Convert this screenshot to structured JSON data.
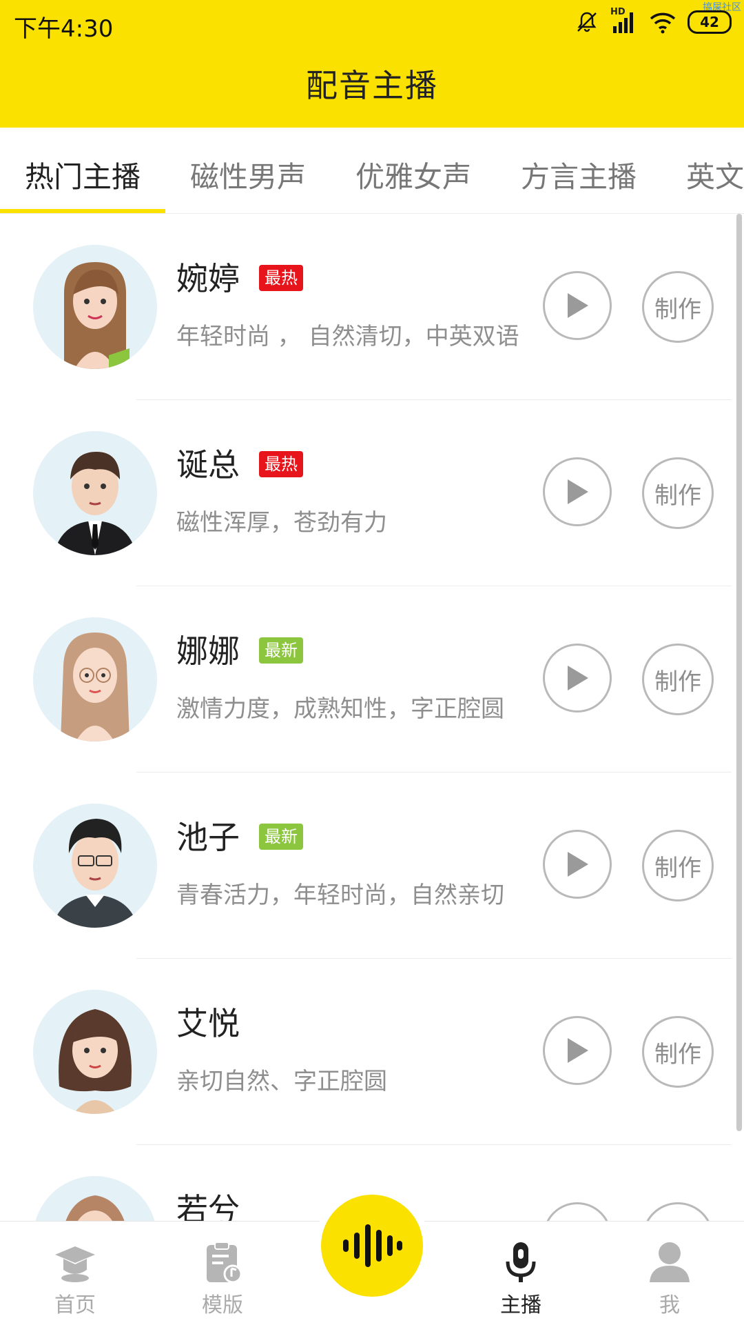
{
  "status_bar": {
    "time": "下午4:30",
    "battery": "42",
    "hd": "HD",
    "watermark": "搞屎社区"
  },
  "header": {
    "title": "配音主播"
  },
  "tabs": [
    {
      "label": "热门主播",
      "active": true
    },
    {
      "label": "磁性男声",
      "active": false
    },
    {
      "label": "优雅女声",
      "active": false
    },
    {
      "label": "方言主播",
      "active": false
    },
    {
      "label": "英文",
      "active": false
    }
  ],
  "anchors": [
    {
      "name": "婉婷",
      "badge": "最热",
      "badge_type": "hot",
      "desc": "年轻时尚 ， 自然清切，中英双语"
    },
    {
      "name": "诞总",
      "badge": "最热",
      "badge_type": "hot",
      "desc": "磁性浑厚，苍劲有力"
    },
    {
      "name": "娜娜",
      "badge": "最新",
      "badge_type": "new",
      "desc": "激情力度，成熟知性，字正腔圆"
    },
    {
      "name": "池子",
      "badge": "最新",
      "badge_type": "new",
      "desc": "青春活力，年轻时尚，自然亲切"
    },
    {
      "name": "艾悦",
      "badge": "",
      "badge_type": "",
      "desc": "亲切自然、字正腔圆"
    },
    {
      "name": "若兮",
      "badge": "",
      "badge_type": "",
      "desc": ""
    }
  ],
  "actions": {
    "make_label": "制作"
  },
  "bottom_nav": [
    {
      "label": "首页",
      "icon": "graduation-cap-icon",
      "active": false
    },
    {
      "label": "模版",
      "icon": "music-clipboard-icon",
      "active": false
    },
    {
      "label": "主播",
      "icon": "microphone-icon",
      "active": true
    },
    {
      "label": "我",
      "icon": "person-icon",
      "active": false
    }
  ],
  "colors": {
    "brand_yellow": "#fae100",
    "hot_badge": "#e8141c",
    "new_badge": "#8cc63f"
  }
}
